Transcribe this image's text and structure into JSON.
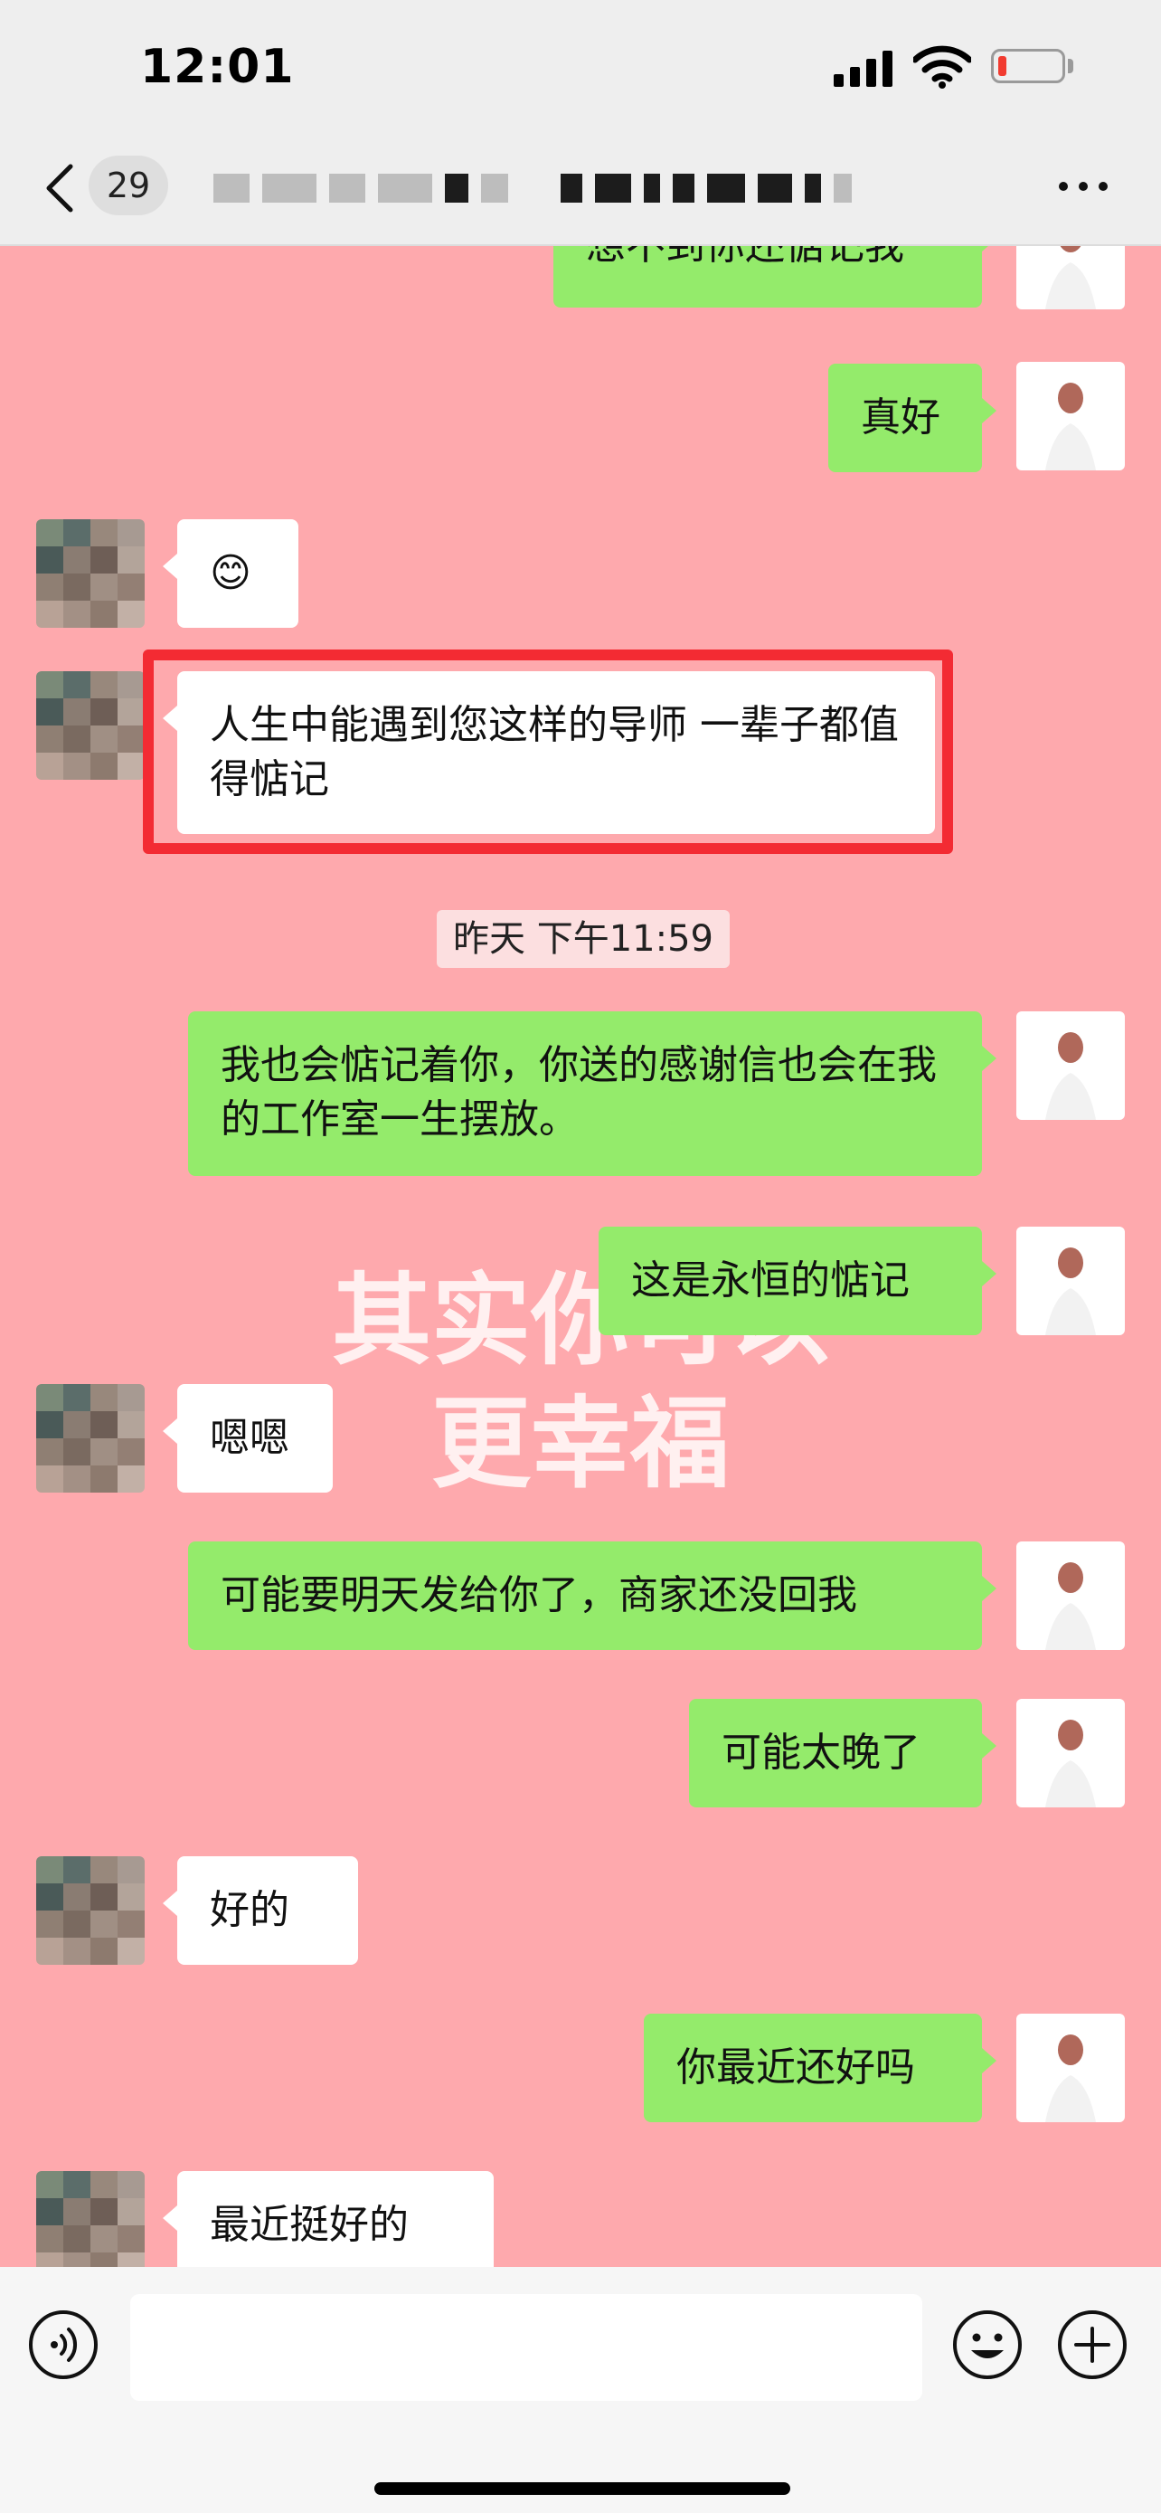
{
  "status_bar": {
    "time": "12:01",
    "battery_level": 0.08,
    "icons": [
      "signal-icon",
      "wifi-icon",
      "battery-icon"
    ]
  },
  "nav": {
    "back_icon": "chevron-left-icon",
    "unread_count": "29",
    "title_obscured": true,
    "more_icon": "ellipsis-icon"
  },
  "chat": {
    "timestamp": "昨天 下午11:59",
    "messages": [
      {
        "from": "self",
        "text": "想不到你还惦记我"
      },
      {
        "from": "self",
        "text": "真好"
      },
      {
        "from": "other",
        "text": "😊"
      },
      {
        "from": "other",
        "text": "人生中能遇到您这样的导师 一辈子都值得惦记"
      },
      {
        "from": "self",
        "text": "我也会惦记着你，你送的感谢信也会在我的工作室一生摆放。"
      },
      {
        "from": "self",
        "text": "这是永恒的惦记"
      },
      {
        "from": "other",
        "text": "嗯嗯"
      },
      {
        "from": "self",
        "text": "可能要明天发给你了，商家还没回我"
      },
      {
        "from": "self",
        "text": "可能太晚了"
      },
      {
        "from": "other",
        "text": "好的"
      },
      {
        "from": "self",
        "text": "你最近还好吗"
      },
      {
        "from": "other",
        "text": "最近挺好的"
      }
    ],
    "watermark_line1": "其实你可以",
    "watermark_line2": "更幸福"
  },
  "colors": {
    "chat_background": "#fea9ad",
    "self_bubble": "#94eb6b",
    "other_bubble": "#ffffff",
    "highlight_box": "#f32b33"
  },
  "input_bar": {
    "voice_icon": "voice-icon",
    "emoji_icon": "smiley-icon",
    "plus_icon": "plus-circle-icon"
  }
}
